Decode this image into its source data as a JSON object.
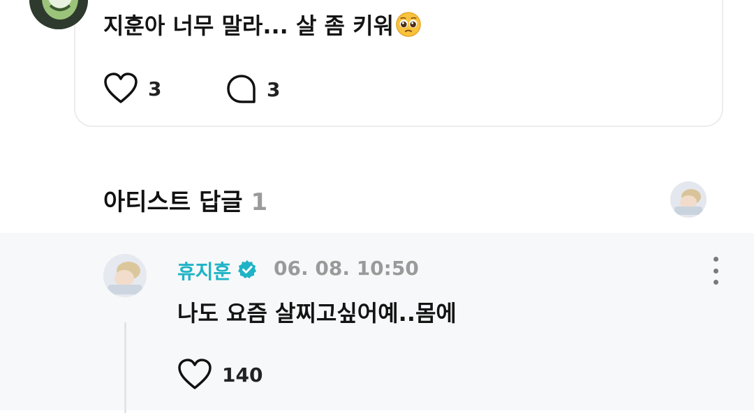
{
  "comment": {
    "text": "지훈아 너무 말라... 살 좀 키워",
    "emoji": "pleading-face-emoji",
    "likes": "3",
    "replies": "3"
  },
  "artist_replies": {
    "title": "아티스트 답글",
    "count": "1"
  },
  "reply": {
    "author": "휴지훈",
    "timestamp": "06. 08. 10:50",
    "text": "나도 요즘 살찌고싶어예..몸에",
    "likes": "140"
  },
  "colors": {
    "author": "#1fb3c6",
    "muted": "#9a9a9a",
    "reply_bg": "#f7f8f9",
    "card_border": "#ececec"
  }
}
